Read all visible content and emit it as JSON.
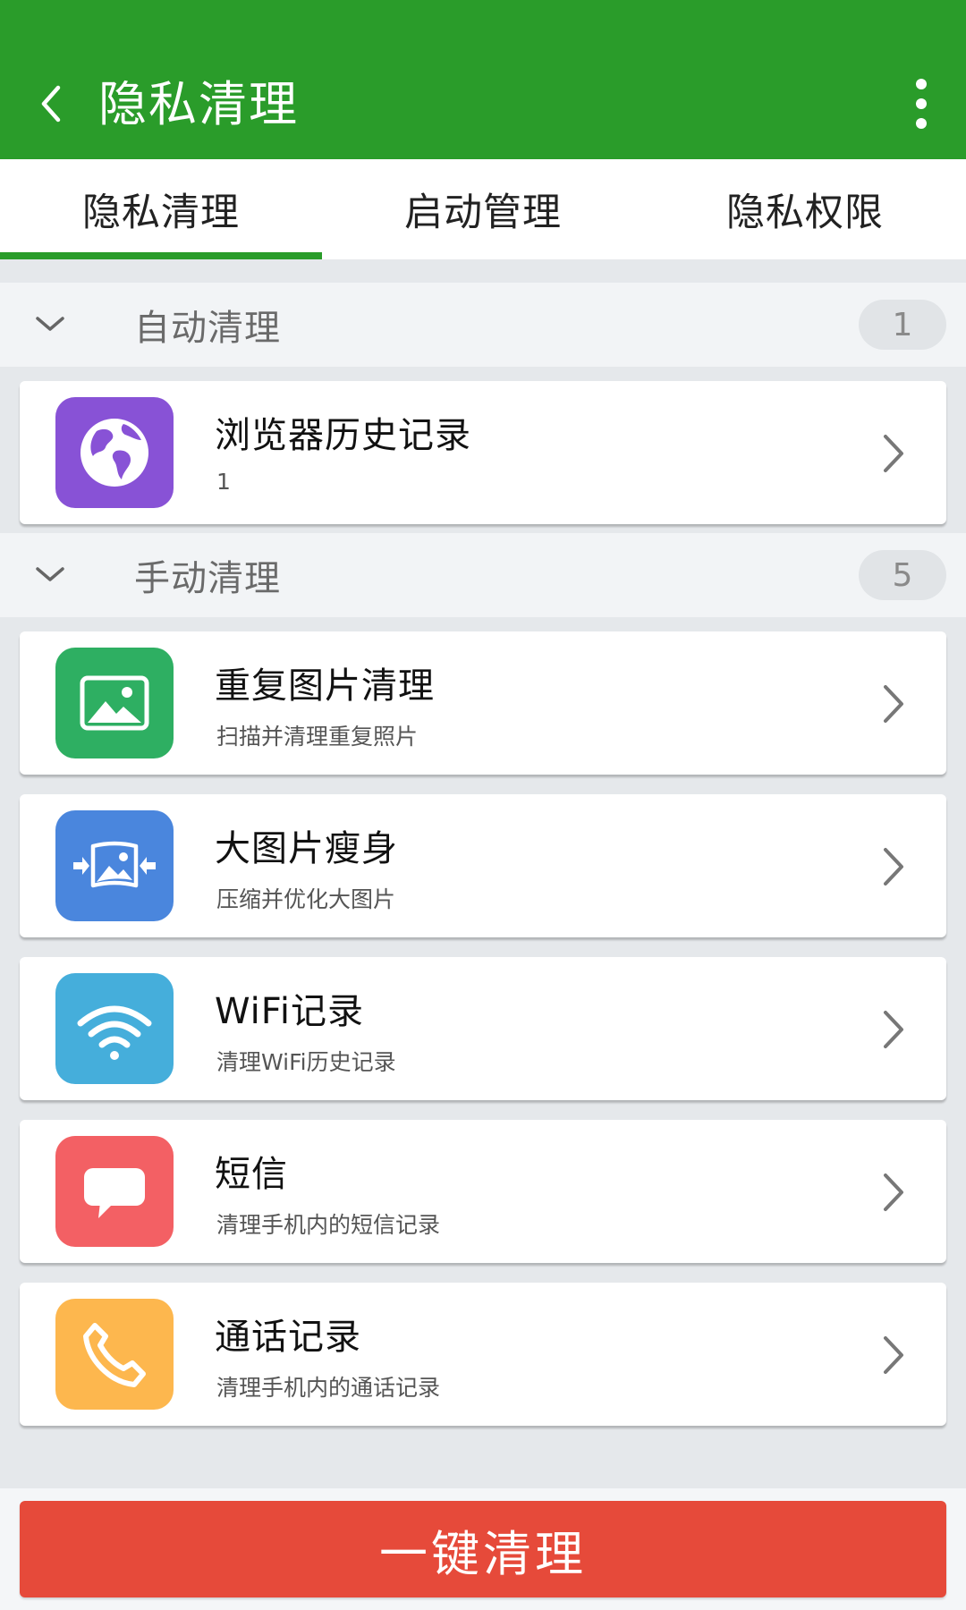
{
  "appbar": {
    "title": "隐私清理",
    "color": "#2a9c2a"
  },
  "tabs": [
    {
      "label": "隐私清理",
      "active": true
    },
    {
      "label": "启动管理",
      "active": false
    },
    {
      "label": "隐私权限",
      "active": false
    }
  ],
  "sections": {
    "auto": {
      "label": "自动清理",
      "count": "1"
    },
    "manual": {
      "label": "手动清理",
      "count": "5"
    }
  },
  "items": [
    {
      "title": "浏览器历史记录",
      "subtitle": "1",
      "icon": "globe-icon",
      "color": "#8852d6"
    },
    {
      "title": "重复图片清理",
      "subtitle": "扫描并清理重复照片",
      "icon": "image-icon",
      "color": "#2eaf62"
    },
    {
      "title": "大图片瘦身",
      "subtitle": "压缩并优化大图片",
      "icon": "compress-image-icon",
      "color": "#4a86dd"
    },
    {
      "title": "WiFi记录",
      "subtitle": "清理WiFi历史记录",
      "icon": "wifi-icon",
      "color": "#45aedb"
    },
    {
      "title": "短信",
      "subtitle": "清理手机内的短信记录",
      "icon": "message-icon",
      "color": "#f36064"
    },
    {
      "title": "通话记录",
      "subtitle": "清理手机内的通话记录",
      "icon": "phone-icon",
      "color": "#fdb74e"
    }
  ],
  "footer": {
    "clean_label": "一键清理",
    "color": "#e64a3a"
  }
}
